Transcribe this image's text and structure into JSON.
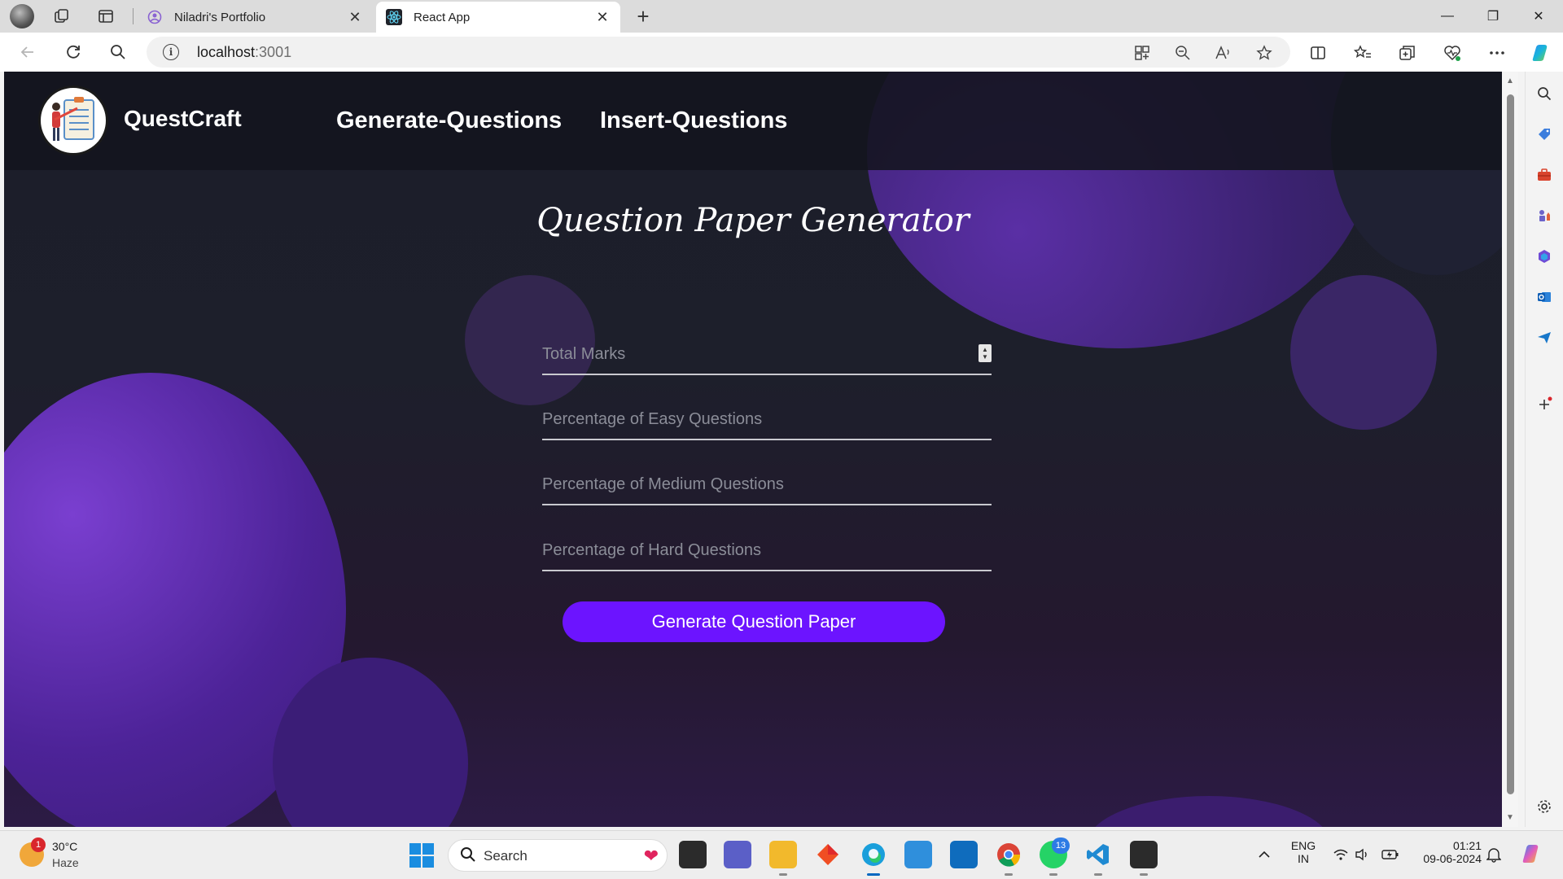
{
  "browser": {
    "tabs": [
      {
        "title": "Niladri's Portfolio",
        "active": false
      },
      {
        "title": "React App",
        "active": true
      }
    ],
    "close_glyph": "✕",
    "new_tab_glyph": "+",
    "url_host": "localhost",
    "url_port": ":3001",
    "window_controls": {
      "minimize": "—",
      "maximize": "❐",
      "close": "✕"
    }
  },
  "app": {
    "brand": "QuestCraft",
    "nav": [
      "Generate-Questions",
      "Insert-Questions"
    ],
    "heading": "Question Paper Generator",
    "form": {
      "total_marks_placeholder": "Total Marks",
      "easy_placeholder": "Percentage of Easy Questions",
      "medium_placeholder": "Percentage of Medium Questions",
      "hard_placeholder": "Percentage of Hard Questions",
      "total_marks_value": "",
      "easy_value": "",
      "medium_value": "",
      "hard_value": ""
    },
    "button_label": "Generate Question Paper",
    "colors": {
      "accent": "#6c14ff",
      "background": "#1c1e2a",
      "blob": "#4d2398"
    }
  },
  "taskbar": {
    "weather": {
      "temp": "30°C",
      "condition": "Haze",
      "badge": "1"
    },
    "search_label": "Search",
    "whatsapp_badge": "13",
    "language": {
      "line1": "ENG",
      "line2": "IN"
    },
    "clock": {
      "time": "01:21",
      "date": "09-06-2024"
    }
  }
}
